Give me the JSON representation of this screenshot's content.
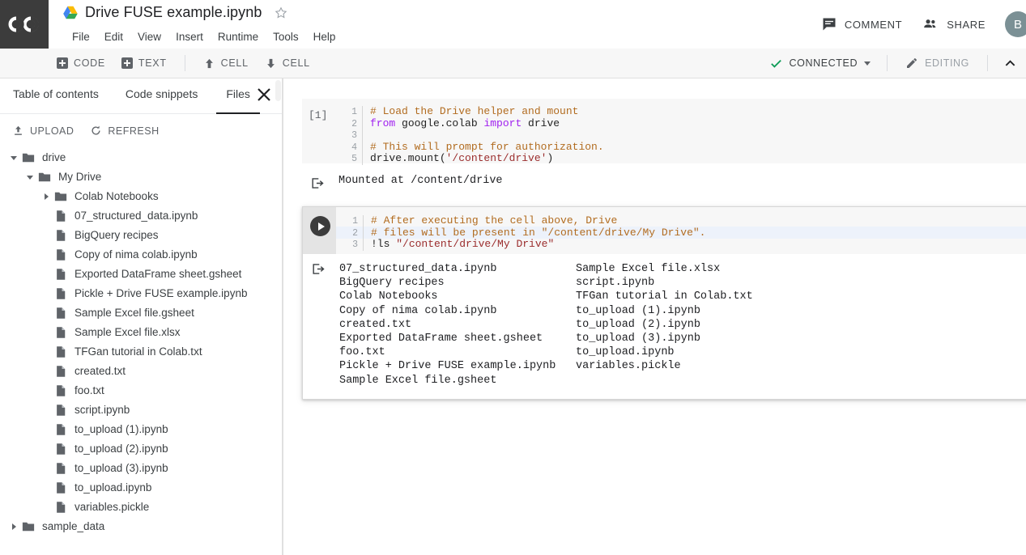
{
  "header": {
    "logo_text": "CO",
    "drive_icon": "google-drive-icon",
    "notebook_title": "Drive FUSE example.ipynb",
    "star_icon": "star-outline-icon",
    "menu": [
      {
        "label": "File"
      },
      {
        "label": "Edit"
      },
      {
        "label": "View"
      },
      {
        "label": "Insert"
      },
      {
        "label": "Runtime"
      },
      {
        "label": "Tools"
      },
      {
        "label": "Help"
      }
    ],
    "comment_label": "COMMENT",
    "comment_icon": "comment-icon",
    "share_label": "SHARE",
    "share_icon": "people-icon",
    "avatar_initial": "B",
    "avatar_color": "#7b9095"
  },
  "toolbar": {
    "add_code_label": "CODE",
    "add_text_label": "TEXT",
    "move_cell_up_label": "CELL",
    "move_cell_down_label": "CELL",
    "connected_label": "CONNECTED",
    "connected_check_color": "#0f9d58",
    "editing_label": "EDITING",
    "editing_icon": "pencil-icon",
    "collapse_icon": "chevron-up-icon"
  },
  "left_panel": {
    "tabs": [
      {
        "label": "Table of contents",
        "active": false
      },
      {
        "label": "Code snippets",
        "active": false
      },
      {
        "label": "Files",
        "active": true
      }
    ],
    "close_icon": "close-icon",
    "actions": [
      {
        "label": "UPLOAD",
        "icon": "upload-icon"
      },
      {
        "label": "REFRESH",
        "icon": "refresh-icon"
      }
    ],
    "tree": [
      {
        "label": "drive",
        "type": "folder",
        "indent": 0,
        "twisty": "down"
      },
      {
        "label": "My Drive",
        "type": "folder",
        "indent": 1,
        "twisty": "down"
      },
      {
        "label": "Colab Notebooks",
        "type": "folder",
        "indent": 2,
        "twisty": "right"
      },
      {
        "label": "07_structured_data.ipynb",
        "type": "file",
        "indent": 2,
        "twisty": "none"
      },
      {
        "label": "BigQuery recipes",
        "type": "file",
        "indent": 2,
        "twisty": "none"
      },
      {
        "label": "Copy of nima colab.ipynb",
        "type": "file",
        "indent": 2,
        "twisty": "none"
      },
      {
        "label": "Exported DataFrame sheet.gsheet",
        "type": "file",
        "indent": 2,
        "twisty": "none"
      },
      {
        "label": "Pickle + Drive FUSE example.ipynb",
        "type": "file",
        "indent": 2,
        "twisty": "none"
      },
      {
        "label": "Sample Excel file.gsheet",
        "type": "file",
        "indent": 2,
        "twisty": "none"
      },
      {
        "label": "Sample Excel file.xlsx",
        "type": "file",
        "indent": 2,
        "twisty": "none"
      },
      {
        "label": "TFGan tutorial in Colab.txt",
        "type": "file",
        "indent": 2,
        "twisty": "none"
      },
      {
        "label": "created.txt",
        "type": "file",
        "indent": 2,
        "twisty": "none"
      },
      {
        "label": "foo.txt",
        "type": "file",
        "indent": 2,
        "twisty": "none"
      },
      {
        "label": "script.ipynb",
        "type": "file",
        "indent": 2,
        "twisty": "none"
      },
      {
        "label": "to_upload (1).ipynb",
        "type": "file",
        "indent": 2,
        "twisty": "none"
      },
      {
        "label": "to_upload (2).ipynb",
        "type": "file",
        "indent": 2,
        "twisty": "none"
      },
      {
        "label": "to_upload (3).ipynb",
        "type": "file",
        "indent": 2,
        "twisty": "none"
      },
      {
        "label": "to_upload.ipynb",
        "type": "file",
        "indent": 2,
        "twisty": "none"
      },
      {
        "label": "variables.pickle",
        "type": "file",
        "indent": 2,
        "twisty": "none"
      },
      {
        "label": "sample_data",
        "type": "folder",
        "indent": 0,
        "twisty": "right"
      }
    ]
  },
  "notebook": {
    "cell1": {
      "prompt": "[1]",
      "lines": [
        {
          "n": "1",
          "segments": [
            {
              "t": "# Load the Drive helper and mount",
              "c": "com"
            }
          ]
        },
        {
          "n": "2",
          "segments": [
            {
              "t": "from",
              "c": "kw"
            },
            {
              "t": " google.colab ",
              "c": "txt"
            },
            {
              "t": "import",
              "c": "kw"
            },
            {
              "t": " drive",
              "c": "txt"
            }
          ]
        },
        {
          "n": "3",
          "segments": [
            {
              "t": "",
              "c": "txt"
            }
          ]
        },
        {
          "n": "4",
          "segments": [
            {
              "t": "# This will prompt for authorization.",
              "c": "com"
            }
          ]
        },
        {
          "n": "5",
          "segments": [
            {
              "t": "drive.mount(",
              "c": "txt"
            },
            {
              "t": "'/content/drive'",
              "c": "str"
            },
            {
              "t": ")",
              "c": "txt"
            }
          ]
        }
      ],
      "output": "Mounted at /content/drive",
      "output_icon": "output-arrow-icon"
    },
    "cell2": {
      "run_icon": "play-icon",
      "menu_icon": "more-vert-icon",
      "lines": [
        {
          "n": "1",
          "segments": [
            {
              "t": "# After executing the cell above, Drive",
              "c": "com"
            }
          ]
        },
        {
          "n": "2",
          "segments": [
            {
              "t": "# files will be present in \"/content/drive/My Drive\".",
              "c": "com"
            }
          ]
        },
        {
          "n": "3",
          "segments": [
            {
              "t": "!ls ",
              "c": "txt"
            },
            {
              "t": "\"/content/drive/My Drive\"",
              "c": "str"
            }
          ]
        }
      ],
      "output_icon": "output-arrow-icon",
      "output_col1": "07_structured_data.ipynb\nBigQuery recipes\nColab Notebooks\nCopy of nima colab.ipynb\ncreated.txt\nExported DataFrame sheet.gsheet\nfoo.txt\nPickle + Drive FUSE example.ipynb\nSample Excel file.gsheet",
      "output_col2": "Sample Excel file.xlsx\nscript.ipynb\nTFGan tutorial in Colab.txt\nto_upload (1).ipynb\nto_upload (2).ipynb\nto_upload (3).ipynb\nto_upload.ipynb\nvariables.pickle"
    }
  }
}
